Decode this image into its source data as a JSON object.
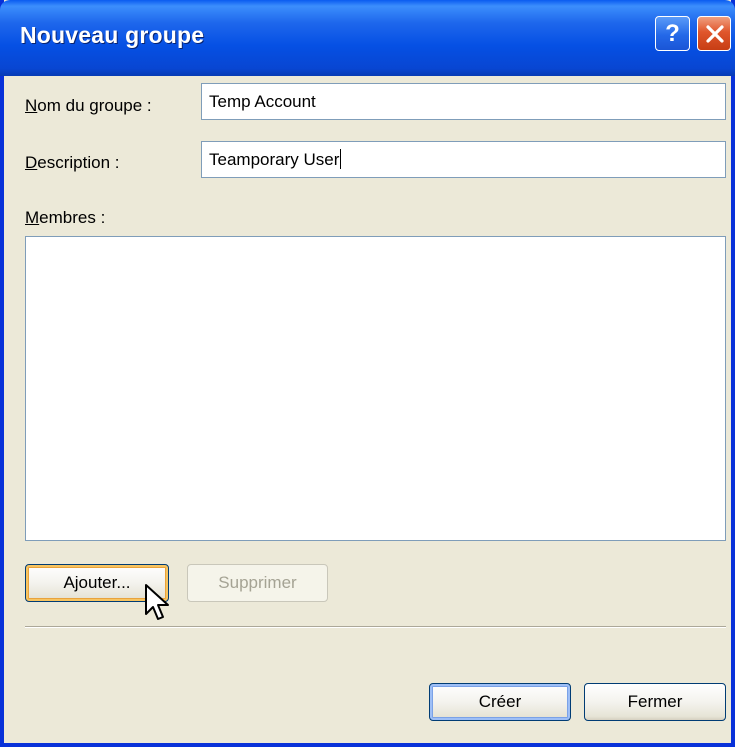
{
  "window": {
    "title": "Nouveau groupe",
    "help_glyph": "?",
    "close_icon": "close-icon"
  },
  "form": {
    "group_name_label": "Nom du groupe :",
    "group_name_value": "Temp Account",
    "description_label": "Description :",
    "description_value": "Teamporary User",
    "members_label": "Membres :",
    "members": []
  },
  "buttons": {
    "add": "Ajouter...",
    "remove": "Supprimer",
    "create": "Créer",
    "close": "Fermer"
  },
  "colors": {
    "titlebar": "#0a5bf0",
    "dialog_bg": "#ece9d8",
    "field_border": "#7f9db9"
  }
}
